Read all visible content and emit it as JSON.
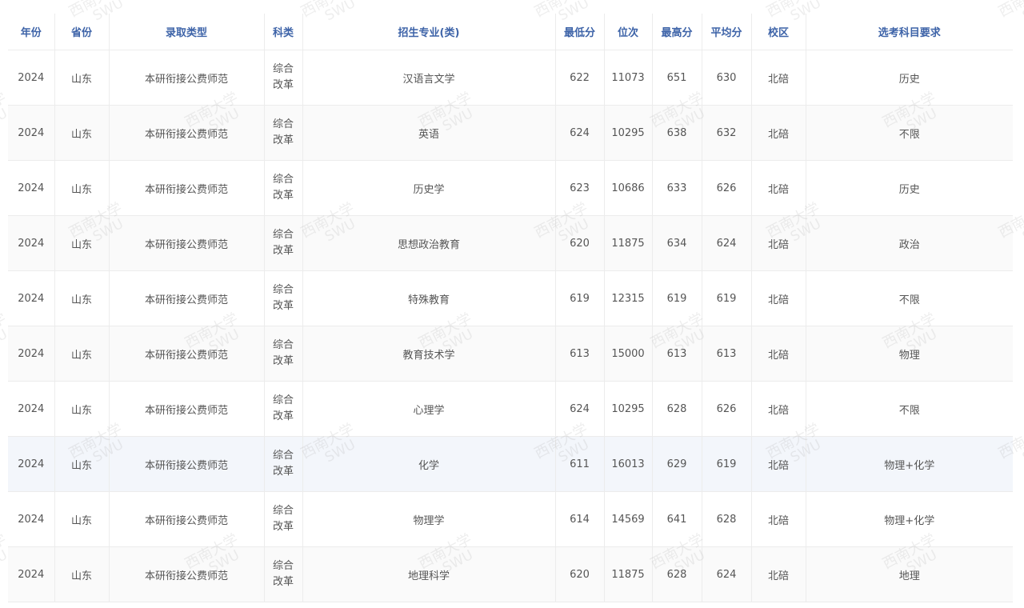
{
  "table": {
    "headers": {
      "year": "年份",
      "province": "省份",
      "admission_type": "录取类型",
      "category": "科类",
      "major": "招生专业(类)",
      "min_score": "最低分",
      "rank": "位次",
      "max_score": "最高分",
      "avg_score": "平均分",
      "campus": "校区",
      "subject_req": "选考科目要求"
    },
    "rows": [
      {
        "year": "2024",
        "province": "山东",
        "admission_type": "本研衔接公费师范",
        "category_line1": "综合",
        "category_line2": "改革",
        "major": "汉语言文学",
        "min_score": "622",
        "rank": "11073",
        "max_score": "651",
        "avg_score": "630",
        "campus": "北碚",
        "subject_req": "历史"
      },
      {
        "year": "2024",
        "province": "山东",
        "admission_type": "本研衔接公费师范",
        "category_line1": "综合",
        "category_line2": "改革",
        "major": "英语",
        "min_score": "624",
        "rank": "10295",
        "max_score": "638",
        "avg_score": "632",
        "campus": "北碚",
        "subject_req": "不限"
      },
      {
        "year": "2024",
        "province": "山东",
        "admission_type": "本研衔接公费师范",
        "category_line1": "综合",
        "category_line2": "改革",
        "major": "历史学",
        "min_score": "623",
        "rank": "10686",
        "max_score": "633",
        "avg_score": "626",
        "campus": "北碚",
        "subject_req": "历史"
      },
      {
        "year": "2024",
        "province": "山东",
        "admission_type": "本研衔接公费师范",
        "category_line1": "综合",
        "category_line2": "改革",
        "major": "思想政治教育",
        "min_score": "620",
        "rank": "11875",
        "max_score": "634",
        "avg_score": "624",
        "campus": "北碚",
        "subject_req": "政治"
      },
      {
        "year": "2024",
        "province": "山东",
        "admission_type": "本研衔接公费师范",
        "category_line1": "综合",
        "category_line2": "改革",
        "major": "特殊教育",
        "min_score": "619",
        "rank": "12315",
        "max_score": "619",
        "avg_score": "619",
        "campus": "北碚",
        "subject_req": "不限"
      },
      {
        "year": "2024",
        "province": "山东",
        "admission_type": "本研衔接公费师范",
        "category_line1": "综合",
        "category_line2": "改革",
        "major": "教育技术学",
        "min_score": "613",
        "rank": "15000",
        "max_score": "613",
        "avg_score": "613",
        "campus": "北碚",
        "subject_req": "物理"
      },
      {
        "year": "2024",
        "province": "山东",
        "admission_type": "本研衔接公费师范",
        "category_line1": "综合",
        "category_line2": "改革",
        "major": "心理学",
        "min_score": "624",
        "rank": "10295",
        "max_score": "628",
        "avg_score": "626",
        "campus": "北碚",
        "subject_req": "不限"
      },
      {
        "year": "2024",
        "province": "山东",
        "admission_type": "本研衔接公费师范",
        "category_line1": "综合",
        "category_line2": "改革",
        "major": "化学",
        "min_score": "611",
        "rank": "16013",
        "max_score": "629",
        "avg_score": "619",
        "campus": "北碚",
        "subject_req": "物理+化学"
      },
      {
        "year": "2024",
        "province": "山东",
        "admission_type": "本研衔接公费师范",
        "category_line1": "综合",
        "category_line2": "改革",
        "major": "物理学",
        "min_score": "614",
        "rank": "14569",
        "max_score": "641",
        "avg_score": "628",
        "campus": "北碚",
        "subject_req": "物理+化学"
      },
      {
        "year": "2024",
        "province": "山东",
        "admission_type": "本研衔接公费师范",
        "category_line1": "综合",
        "category_line2": "改革",
        "major": "地理科学",
        "min_score": "620",
        "rank": "11875",
        "max_score": "628",
        "avg_score": "624",
        "campus": "北碚",
        "subject_req": "地理"
      }
    ],
    "highlighted_row_index": 7
  },
  "watermark": {
    "cn": "西南大学",
    "en": "SWU"
  },
  "colors": {
    "header_text": "#3d63a8",
    "body_text": "#555555",
    "border": "#ececec",
    "stripe": "#fafafa",
    "highlight": "#f3f6fb"
  }
}
